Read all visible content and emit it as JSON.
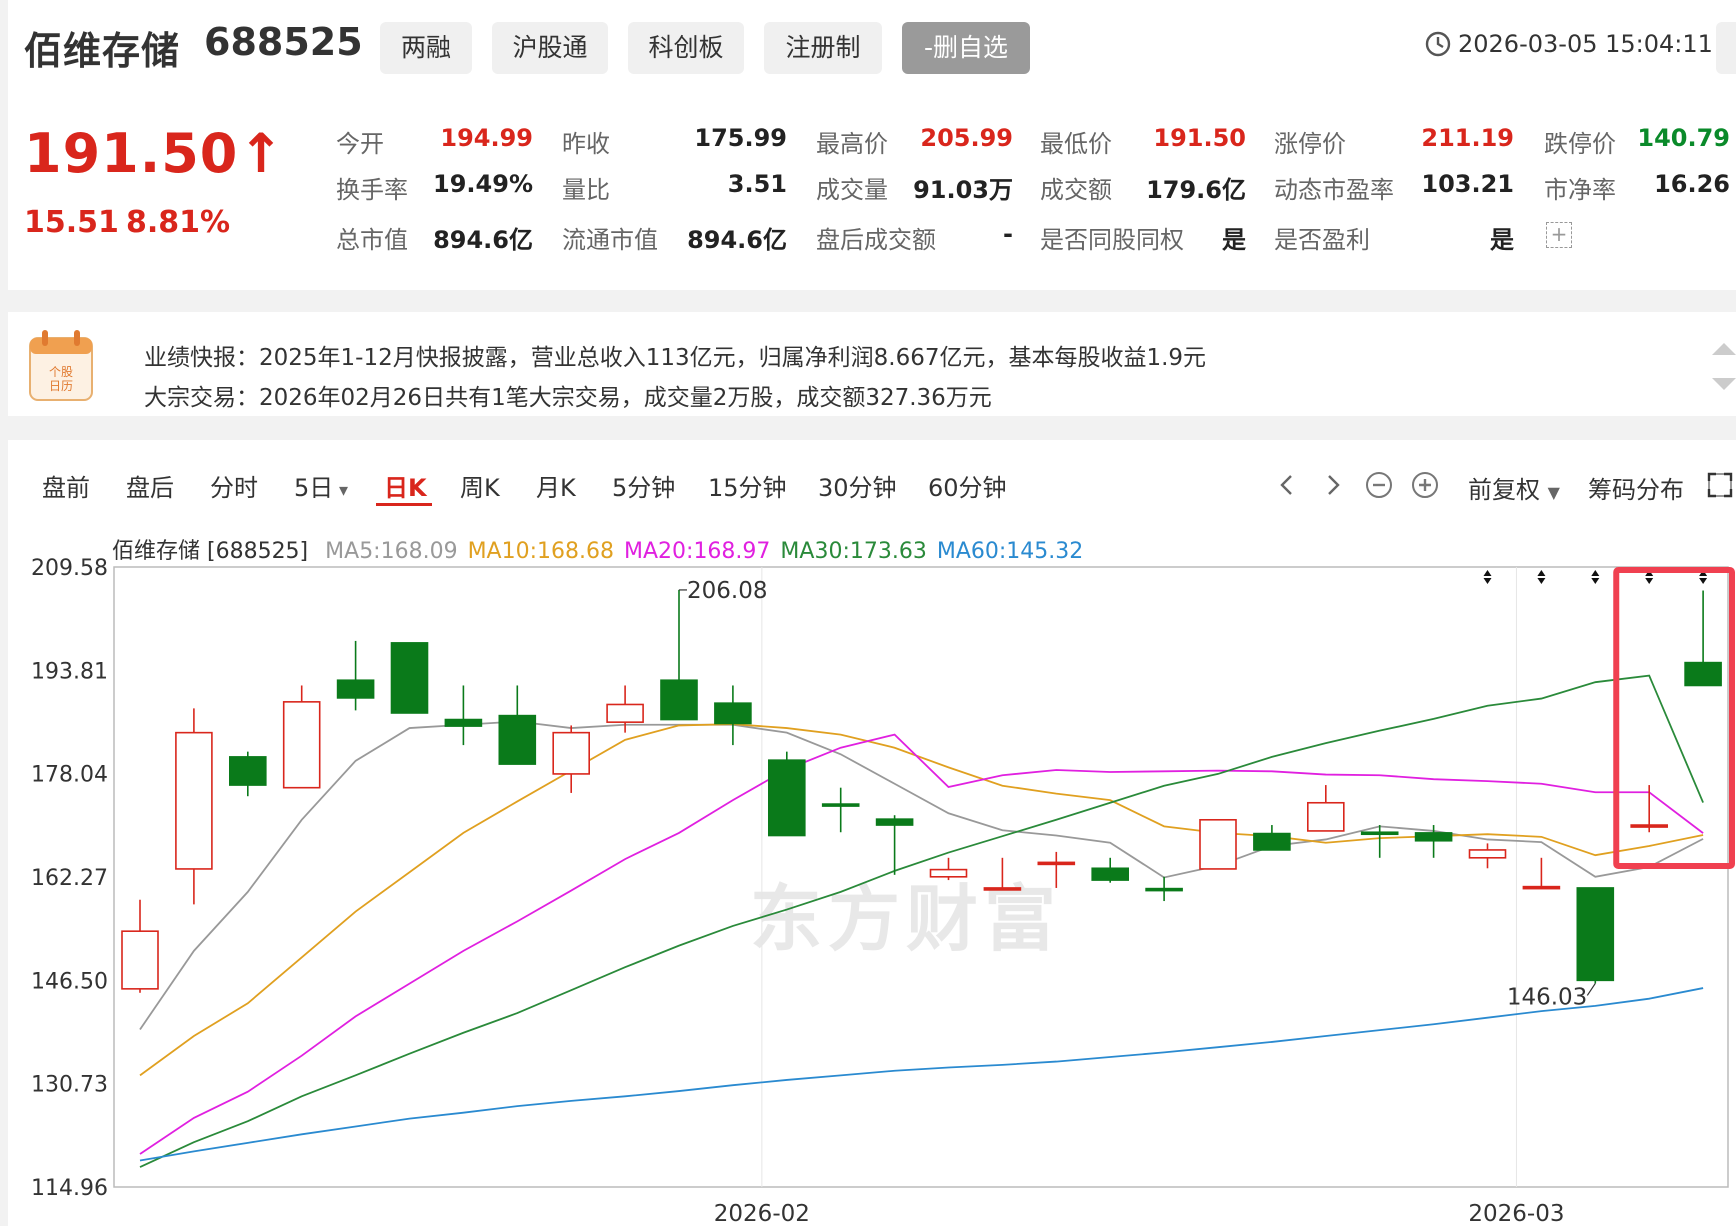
{
  "header": {
    "name": "佰维存储",
    "code": "688525",
    "tags": [
      "两融",
      "沪股通",
      "科创板",
      "注册制"
    ],
    "watch_button": "-删自选",
    "datetime": "2026-03-05 15:04:11",
    "price": "191.50",
    "price_arrow": "↑",
    "change": "15.51",
    "change_pct": "8.81%"
  },
  "quote": {
    "rows": [
      [
        {
          "label": "今开",
          "value": "194.99",
          "tone": "red"
        },
        {
          "label": "昨收",
          "value": "175.99",
          "tone": "normal"
        },
        {
          "label": "最高价",
          "value": "205.99",
          "tone": "red"
        },
        {
          "label": "最低价",
          "value": "191.50",
          "tone": "red"
        },
        {
          "label": "涨停价",
          "value": "211.19",
          "tone": "red"
        },
        {
          "label": "跌停价",
          "value": "140.79",
          "tone": "green"
        }
      ],
      [
        {
          "label": "换手率",
          "value": "19.49%",
          "tone": "normal"
        },
        {
          "label": "量比",
          "value": "3.51",
          "tone": "normal"
        },
        {
          "label": "成交量",
          "value": "91.03万",
          "tone": "normal"
        },
        {
          "label": "成交额",
          "value": "179.6亿",
          "tone": "normal"
        },
        {
          "label": "动态市盈率",
          "value": "103.21",
          "tone": "normal"
        },
        {
          "label": "市净率",
          "value": "16.26",
          "tone": "normal"
        }
      ],
      [
        {
          "label": "总市值",
          "value": "894.6亿",
          "tone": "normal"
        },
        {
          "label": "流通市值",
          "value": "894.6亿",
          "tone": "normal"
        },
        {
          "label": "盘后成交额",
          "value": "-",
          "tone": "normal"
        },
        {
          "label": "是否同股同权",
          "value": "是",
          "tone": "normal"
        },
        {
          "label": "是否盈利",
          "value": "是",
          "tone": "normal"
        }
      ]
    ],
    "expand_icon": "plus-square-icon"
  },
  "news": {
    "calendar_label": "个股日历",
    "lines": [
      "业绩快报：2025年1-12月快报披露，营业总收入113亿元，归属净利润8.667亿元，基本每股收益1.9元",
      "大宗交易：2026年02月26日共有1笔大宗交易，成交量2万股，成交额327.36万元"
    ]
  },
  "toolbar": {
    "tabs": [
      "盘前",
      "盘后",
      "分时",
      "5日",
      "日K",
      "周K",
      "月K",
      "5分钟",
      "15分钟",
      "30分钟",
      "60分钟"
    ],
    "active_tab": "日K",
    "adjust": "前复权",
    "chip": "筹码分布",
    "icons": [
      "chevron-left-icon",
      "chevron-right-icon",
      "zoom-out-icon",
      "zoom-in-icon",
      "fullscreen-icon"
    ]
  },
  "legend": {
    "title": "佰维存储 [688525]",
    "ma": [
      {
        "label": "MA5:168.09",
        "color": "#999999"
      },
      {
        "label": "MA10:168.68",
        "color": "#e0a020"
      },
      {
        "label": "MA20:168.97",
        "color": "#e020e0"
      },
      {
        "label": "MA30:173.63",
        "color": "#2a8a3a"
      },
      {
        "label": "MA60:145.32",
        "color": "#2a8ad0"
      }
    ]
  },
  "watermark": "东方财富",
  "chart_data": {
    "type": "candlestick",
    "yticks": [
      "209.58",
      "193.81",
      "178.04",
      "162.27",
      "146.50",
      "130.73",
      "114.96"
    ],
    "ylim": [
      114.96,
      209.58
    ],
    "xticks": [
      {
        "label": "2026-02",
        "index": 12
      },
      {
        "label": "2026-03",
        "index": 26
      }
    ],
    "candles": [
      {
        "o": 145.2,
        "c": 154.0,
        "h": 158.8,
        "l": 144.6
      },
      {
        "o": 163.5,
        "c": 184.3,
        "h": 188.0,
        "l": 158.1
      },
      {
        "o": 180.6,
        "c": 176.3,
        "h": 181.4,
        "l": 174.6
      },
      {
        "o": 175.9,
        "c": 189.0,
        "h": 191.5,
        "l": 175.9
      },
      {
        "o": 192.3,
        "c": 189.6,
        "h": 198.3,
        "l": 187.7
      },
      {
        "o": 198.0,
        "c": 187.3,
        "h": 198.0,
        "l": 187.3
      },
      {
        "o": 186.3,
        "c": 185.3,
        "h": 191.5,
        "l": 182.4
      },
      {
        "o": 186.9,
        "c": 179.5,
        "h": 191.5,
        "l": 179.5
      },
      {
        "o": 178.0,
        "c": 184.3,
        "h": 185.4,
        "l": 175.1
      },
      {
        "o": 185.9,
        "c": 188.6,
        "h": 191.5,
        "l": 184.3
      },
      {
        "o": 192.3,
        "c": 186.3,
        "h": 206.08,
        "l": 186.3
      },
      {
        "o": 188.8,
        "c": 185.7,
        "h": 191.5,
        "l": 182.4
      },
      {
        "o": 180.1,
        "c": 168.6,
        "h": 181.4,
        "l": 168.6
      },
      {
        "o": 173.4,
        "c": 173.4,
        "h": 175.9,
        "l": 169.1
      },
      {
        "o": 171.1,
        "c": 170.2,
        "h": 171.7,
        "l": 162.6
      },
      {
        "o": 162.3,
        "c": 163.4,
        "h": 165.2,
        "l": 161.8
      },
      {
        "o": 160.6,
        "c": 160.6,
        "h": 165.2,
        "l": 160.6
      },
      {
        "o": 164.5,
        "c": 164.5,
        "h": 166.1,
        "l": 160.6
      },
      {
        "o": 163.6,
        "c": 161.8,
        "h": 165.2,
        "l": 161.4
      },
      {
        "o": 160.5,
        "c": 160.5,
        "h": 162.3,
        "l": 158.6
      },
      {
        "o": 163.5,
        "c": 171.0,
        "h": 171.0,
        "l": 163.5
      },
      {
        "o": 168.9,
        "c": 166.4,
        "h": 170.2,
        "l": 166.4
      },
      {
        "o": 169.3,
        "c": 173.6,
        "h": 176.3,
        "l": 169.3
      },
      {
        "o": 169.1,
        "c": 168.9,
        "h": 170.2,
        "l": 165.2
      },
      {
        "o": 169.0,
        "c": 167.8,
        "h": 170.2,
        "l": 165.2
      },
      {
        "o": 165.2,
        "c": 166.4,
        "h": 167.4,
        "l": 163.6
      },
      {
        "o": 160.8,
        "c": 160.8,
        "h": 165.2,
        "l": 160.8
      },
      {
        "o": 160.6,
        "c": 146.5,
        "h": 160.6,
        "l": 146.03
      },
      {
        "o": 170.2,
        "c": 170.2,
        "h": 176.3,
        "l": 169.1
      },
      {
        "o": 194.99,
        "c": 191.5,
        "h": 205.99,
        "l": 191.5
      }
    ],
    "ma_series": [
      {
        "name": "MA5",
        "color": "#999999",
        "values": [
          139,
          151,
          160,
          171,
          180,
          185,
          185.5,
          186,
          185,
          185.5,
          185.5,
          185.5,
          184.3,
          181,
          176.5,
          172,
          169.4,
          168.6,
          167.5,
          162.2,
          164,
          167,
          168,
          170,
          169.3,
          168,
          167.6,
          162.3,
          163.8,
          168.09
        ]
      },
      {
        "name": "MA10",
        "color": "#e0a020",
        "values": [
          132,
          138,
          143,
          150,
          157,
          163,
          169,
          173.8,
          178.5,
          183.2,
          185.4,
          185.6,
          185,
          184,
          182,
          179,
          176.2,
          175,
          174,
          170,
          169,
          168.5,
          167.5,
          168.2,
          168.5,
          168.8,
          168.4,
          165.6,
          167,
          168.68
        ]
      },
      {
        "name": "MA20",
        "color": "#e020e0",
        "values": [
          120,
          125.5,
          129.5,
          135,
          141,
          146,
          151,
          155.5,
          160.2,
          165,
          169,
          174,
          178.7,
          182,
          184,
          176,
          177.8,
          178.6,
          178.3,
          178.4,
          178.5,
          178.4,
          177.9,
          177.8,
          177.2,
          176.9,
          176.5,
          175.2,
          175.2,
          168.97
        ]
      },
      {
        "name": "MA30",
        "color": "#2a8a3a",
        "values": [
          118,
          121.8,
          125,
          128.8,
          132,
          135.3,
          138.5,
          141.5,
          145,
          148.5,
          151.8,
          154.8,
          157.3,
          160,
          163.2,
          166,
          168.5,
          171,
          173.6,
          176.2,
          178,
          180.6,
          182.7,
          184.6,
          186.4,
          188.4,
          189.5,
          192,
          193,
          173.63
        ]
      },
      {
        "name": "MA60",
        "color": "#2a8ad0",
        "values": [
          119,
          120.4,
          121.7,
          123,
          124.2,
          125.4,
          126.3,
          127.3,
          128.1,
          128.8,
          129.6,
          130.5,
          131.3,
          132,
          132.7,
          133.2,
          133.6,
          134.1,
          134.8,
          135.5,
          136.3,
          137.1,
          138,
          138.9,
          139.8,
          140.8,
          141.8,
          142.6,
          143.7,
          145.32
        ]
      }
    ],
    "annotations": [
      {
        "text": "206.08",
        "index": 10,
        "value": 206.08
      },
      {
        "text": "146.03",
        "index": 27,
        "value": 146.03
      }
    ],
    "markers": [
      25,
      26,
      27,
      28,
      29
    ],
    "highlight": {
      "from_index": 28,
      "to_index": 29,
      "color": "#f04050"
    },
    "up_color": "#d9261c",
    "down_color": "#0a7a1a"
  }
}
